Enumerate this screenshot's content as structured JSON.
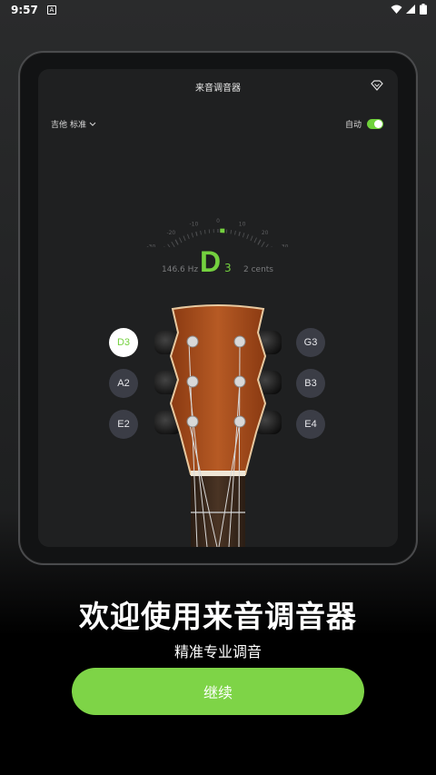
{
  "status_bar": {
    "time": "9:57",
    "notification": "A"
  },
  "app": {
    "title": "来音调音器",
    "instrument": "吉他",
    "tuning": "标准",
    "auto_label": "自动",
    "auto_enabled": true
  },
  "tuner": {
    "note": "D",
    "octave": "3",
    "frequency": "146.6 Hz",
    "cents": "2 cents",
    "scale_labels": [
      "-50",
      "-40",
      "-30",
      "-20",
      "-10",
      "0",
      "10",
      "20",
      "30",
      "40",
      "50"
    ],
    "needle_value": 2
  },
  "strings": [
    {
      "label": "D3",
      "active": true
    },
    {
      "label": "A2",
      "active": false
    },
    {
      "label": "E2",
      "active": false
    },
    {
      "label": "G3",
      "active": false
    },
    {
      "label": "B3",
      "active": false
    },
    {
      "label": "E4",
      "active": false
    }
  ],
  "welcome": {
    "title": "欢迎使用来音调音器",
    "subtitle": "精准专业调音",
    "continue_label": "继续"
  },
  "colors": {
    "accent": "#7ed447",
    "background": "#1f2021",
    "string_button": "#3b3d46"
  }
}
